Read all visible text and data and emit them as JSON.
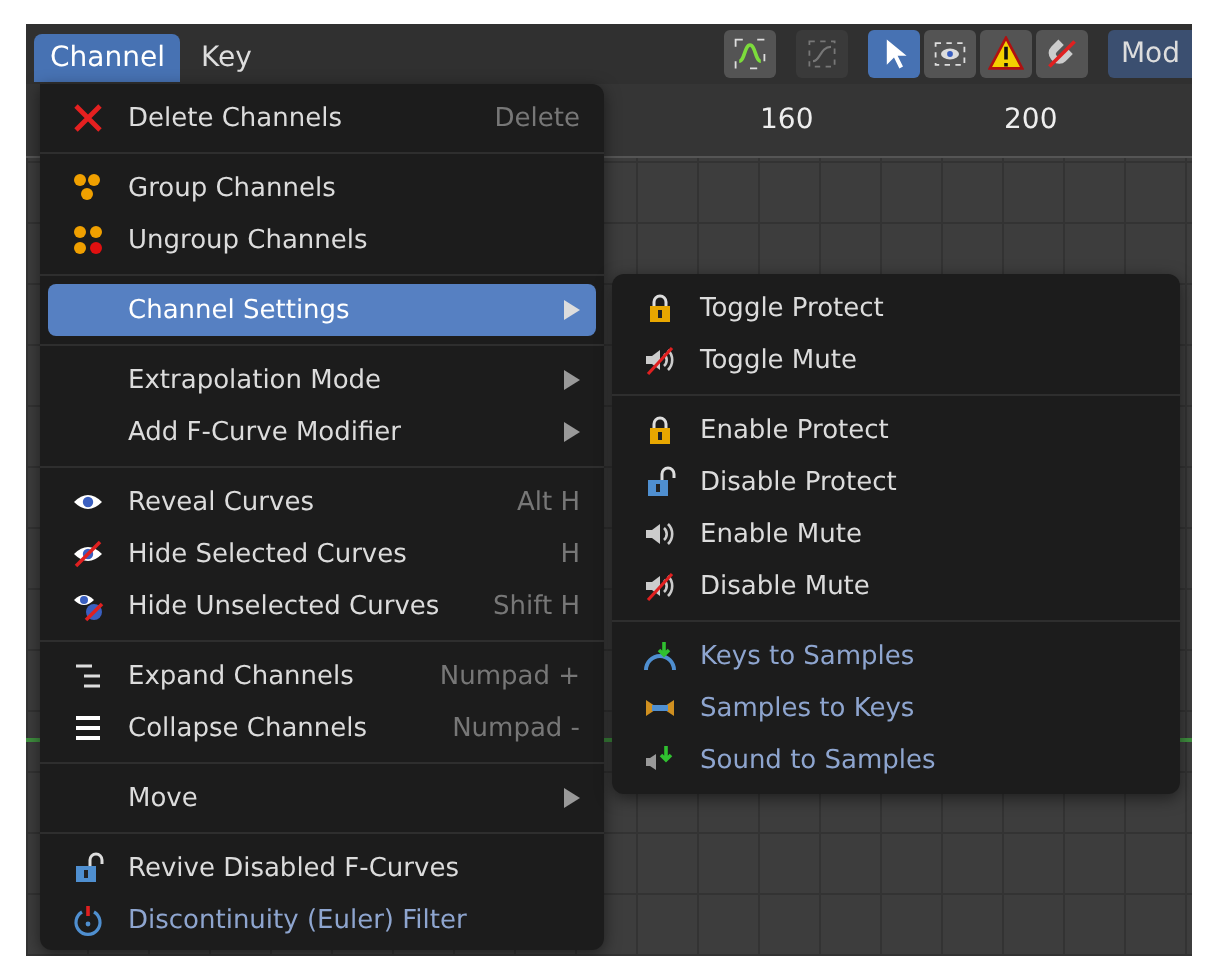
{
  "header": {
    "tabs": [
      {
        "label": "Channel",
        "selected": true
      },
      {
        "label": "Key",
        "selected": false
      }
    ],
    "toolbar": [
      {
        "selected": false,
        "disabled": false
      },
      {
        "selected": false,
        "disabled": true
      },
      {
        "selected": true,
        "disabled": false
      },
      {
        "selected": false,
        "disabled": false
      },
      {
        "selected": false,
        "disabled": false
      },
      {
        "selected": false,
        "disabled": false
      }
    ],
    "mode_button": "Mod"
  },
  "ruler": [
    "160",
    "200"
  ],
  "menu": {
    "sections": [
      [
        {
          "label": "Delete Channels",
          "shortcut": "Delete",
          "has_submenu": false,
          "selected": false,
          "tinted": false
        }
      ],
      [
        {
          "label": "Group Channels",
          "has_submenu": false,
          "selected": false,
          "tinted": false
        },
        {
          "label": "Ungroup Channels",
          "has_submenu": false,
          "selected": false,
          "tinted": false
        }
      ],
      [
        {
          "label": "Channel Settings",
          "has_submenu": true,
          "selected": true,
          "tinted": false
        }
      ],
      [
        {
          "label": "Extrapolation Mode",
          "has_submenu": true,
          "selected": false,
          "tinted": false
        },
        {
          "label": "Add F-Curve Modifier",
          "has_submenu": true,
          "selected": false,
          "tinted": false
        }
      ],
      [
        {
          "label": "Reveal Curves",
          "shortcut": "Alt H",
          "has_submenu": false,
          "selected": false,
          "tinted": false
        },
        {
          "label": "Hide Selected Curves",
          "shortcut": "H",
          "has_submenu": false,
          "selected": false,
          "tinted": false
        },
        {
          "label": "Hide Unselected Curves",
          "shortcut": "Shift H",
          "has_submenu": false,
          "selected": false,
          "tinted": false
        }
      ],
      [
        {
          "label": "Expand Channels",
          "shortcut": "Numpad +",
          "has_submenu": false,
          "selected": false,
          "tinted": false
        },
        {
          "label": "Collapse Channels",
          "shortcut": "Numpad -",
          "has_submenu": false,
          "selected": false,
          "tinted": false
        }
      ],
      [
        {
          "label": "Move",
          "has_submenu": true,
          "selected": false,
          "tinted": false
        }
      ],
      [
        {
          "label": "Revive Disabled F-Curves",
          "has_submenu": false,
          "selected": false,
          "tinted": false
        },
        {
          "label": "Discontinuity (Euler) Filter",
          "has_submenu": false,
          "selected": false,
          "tinted": true
        }
      ]
    ]
  },
  "submenu": {
    "sections": [
      [
        {
          "label": "Toggle Protect",
          "selected": false,
          "tinted": false
        },
        {
          "label": "Toggle Mute",
          "selected": false,
          "tinted": false
        }
      ],
      [
        {
          "label": "Enable Protect",
          "selected": false,
          "tinted": false
        },
        {
          "label": "Disable Protect",
          "selected": false,
          "tinted": false
        },
        {
          "label": "Enable Mute",
          "selected": false,
          "tinted": false
        },
        {
          "label": "Disable Mute",
          "selected": false,
          "tinted": false
        }
      ],
      [
        {
          "label": "Keys to Samples",
          "selected": false,
          "tinted": true
        },
        {
          "label": "Samples to Keys",
          "selected": false,
          "tinted": true
        },
        {
          "label": "Sound to Samples",
          "selected": false,
          "tinted": true
        }
      ]
    ]
  }
}
